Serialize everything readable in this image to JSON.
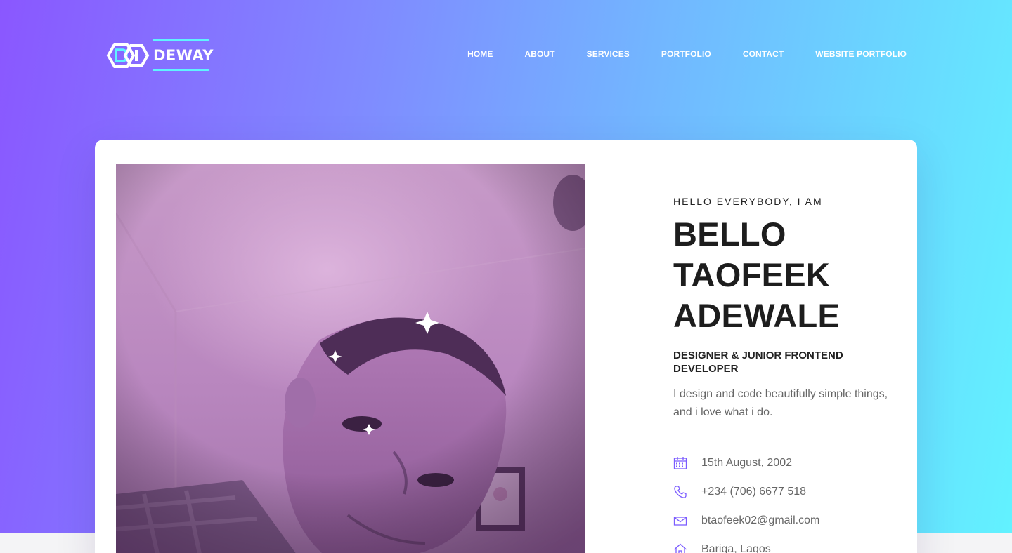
{
  "brand": {
    "name": "DEWAY",
    "logo_icon": "hexagon-logo-icon",
    "accent_color": "#5ff3ff"
  },
  "nav": {
    "items": [
      {
        "label": "HOME"
      },
      {
        "label": "ABOUT"
      },
      {
        "label": "SERVICES"
      },
      {
        "label": "PORTFOLIO"
      },
      {
        "label": "CONTACT"
      },
      {
        "label": "WEBSITE PORTFOLIO"
      }
    ]
  },
  "hero": {
    "gradient_start": "#8a57ff",
    "gradient_end": "#62f2ff",
    "greeting": "HELLO EVERYBODY, I AM",
    "name_lines": [
      "BELLO",
      "TAOFEEK",
      "ADEWALE"
    ],
    "role": "DESIGNER & JUNIOR FRONTEND DEVELOPER",
    "bio": "I design and code beautifully simple things, and i love what i do.",
    "contacts": [
      {
        "icon": "calendar-icon",
        "value": "15th August, 2002"
      },
      {
        "icon": "phone-icon",
        "value": "+234 (706) 6677 518"
      },
      {
        "icon": "mail-icon",
        "value": "btaofeek02@gmail.com"
      },
      {
        "icon": "home-icon",
        "value": "Bariga, Lagos"
      }
    ],
    "icon_color": "#7b5cff"
  }
}
